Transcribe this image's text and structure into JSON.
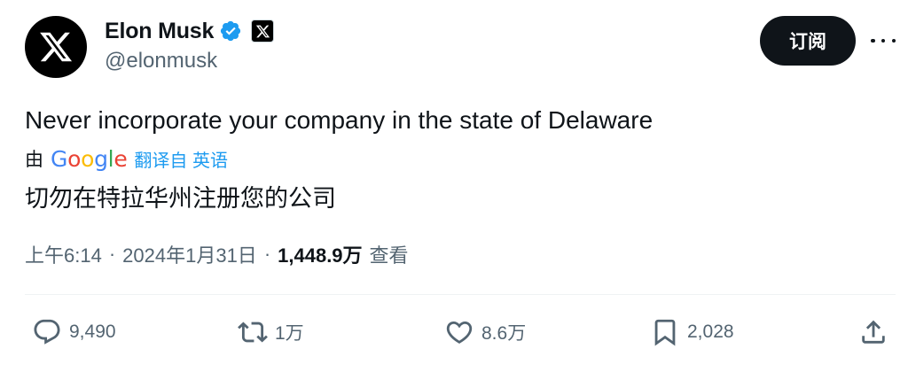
{
  "author": {
    "display_name": "Elon Musk",
    "handle": "@elonmusk",
    "avatar_icon": "x-logo-icon",
    "verified_icon": "verified-badge-icon",
    "verified_color": "#1d9bf0",
    "affiliation_icon": "x-logo-icon"
  },
  "header": {
    "subscribe_label": "订阅",
    "more_icon": "more-dots-icon"
  },
  "tweet": {
    "text": "Never incorporate your company in the state of Delaware",
    "translation": {
      "by_label": "由",
      "provider": "Google",
      "from_label": "翻译自 英语",
      "text": "切勿在特拉华州注册您的公司",
      "link_color": "#1d9bf0"
    },
    "meta": {
      "time": "上午6:14",
      "separator": "·",
      "date": "2024年1月31日",
      "views_count": "1,448.9万",
      "views_label": "查看"
    }
  },
  "actions": {
    "reply": {
      "icon": "reply-icon",
      "count": "9,490"
    },
    "repost": {
      "icon": "repost-icon",
      "count": "1万"
    },
    "like": {
      "icon": "heart-icon",
      "count": "8.6万"
    },
    "bookmark": {
      "icon": "bookmark-icon",
      "count": "2,028"
    },
    "share": {
      "icon": "share-icon"
    }
  }
}
